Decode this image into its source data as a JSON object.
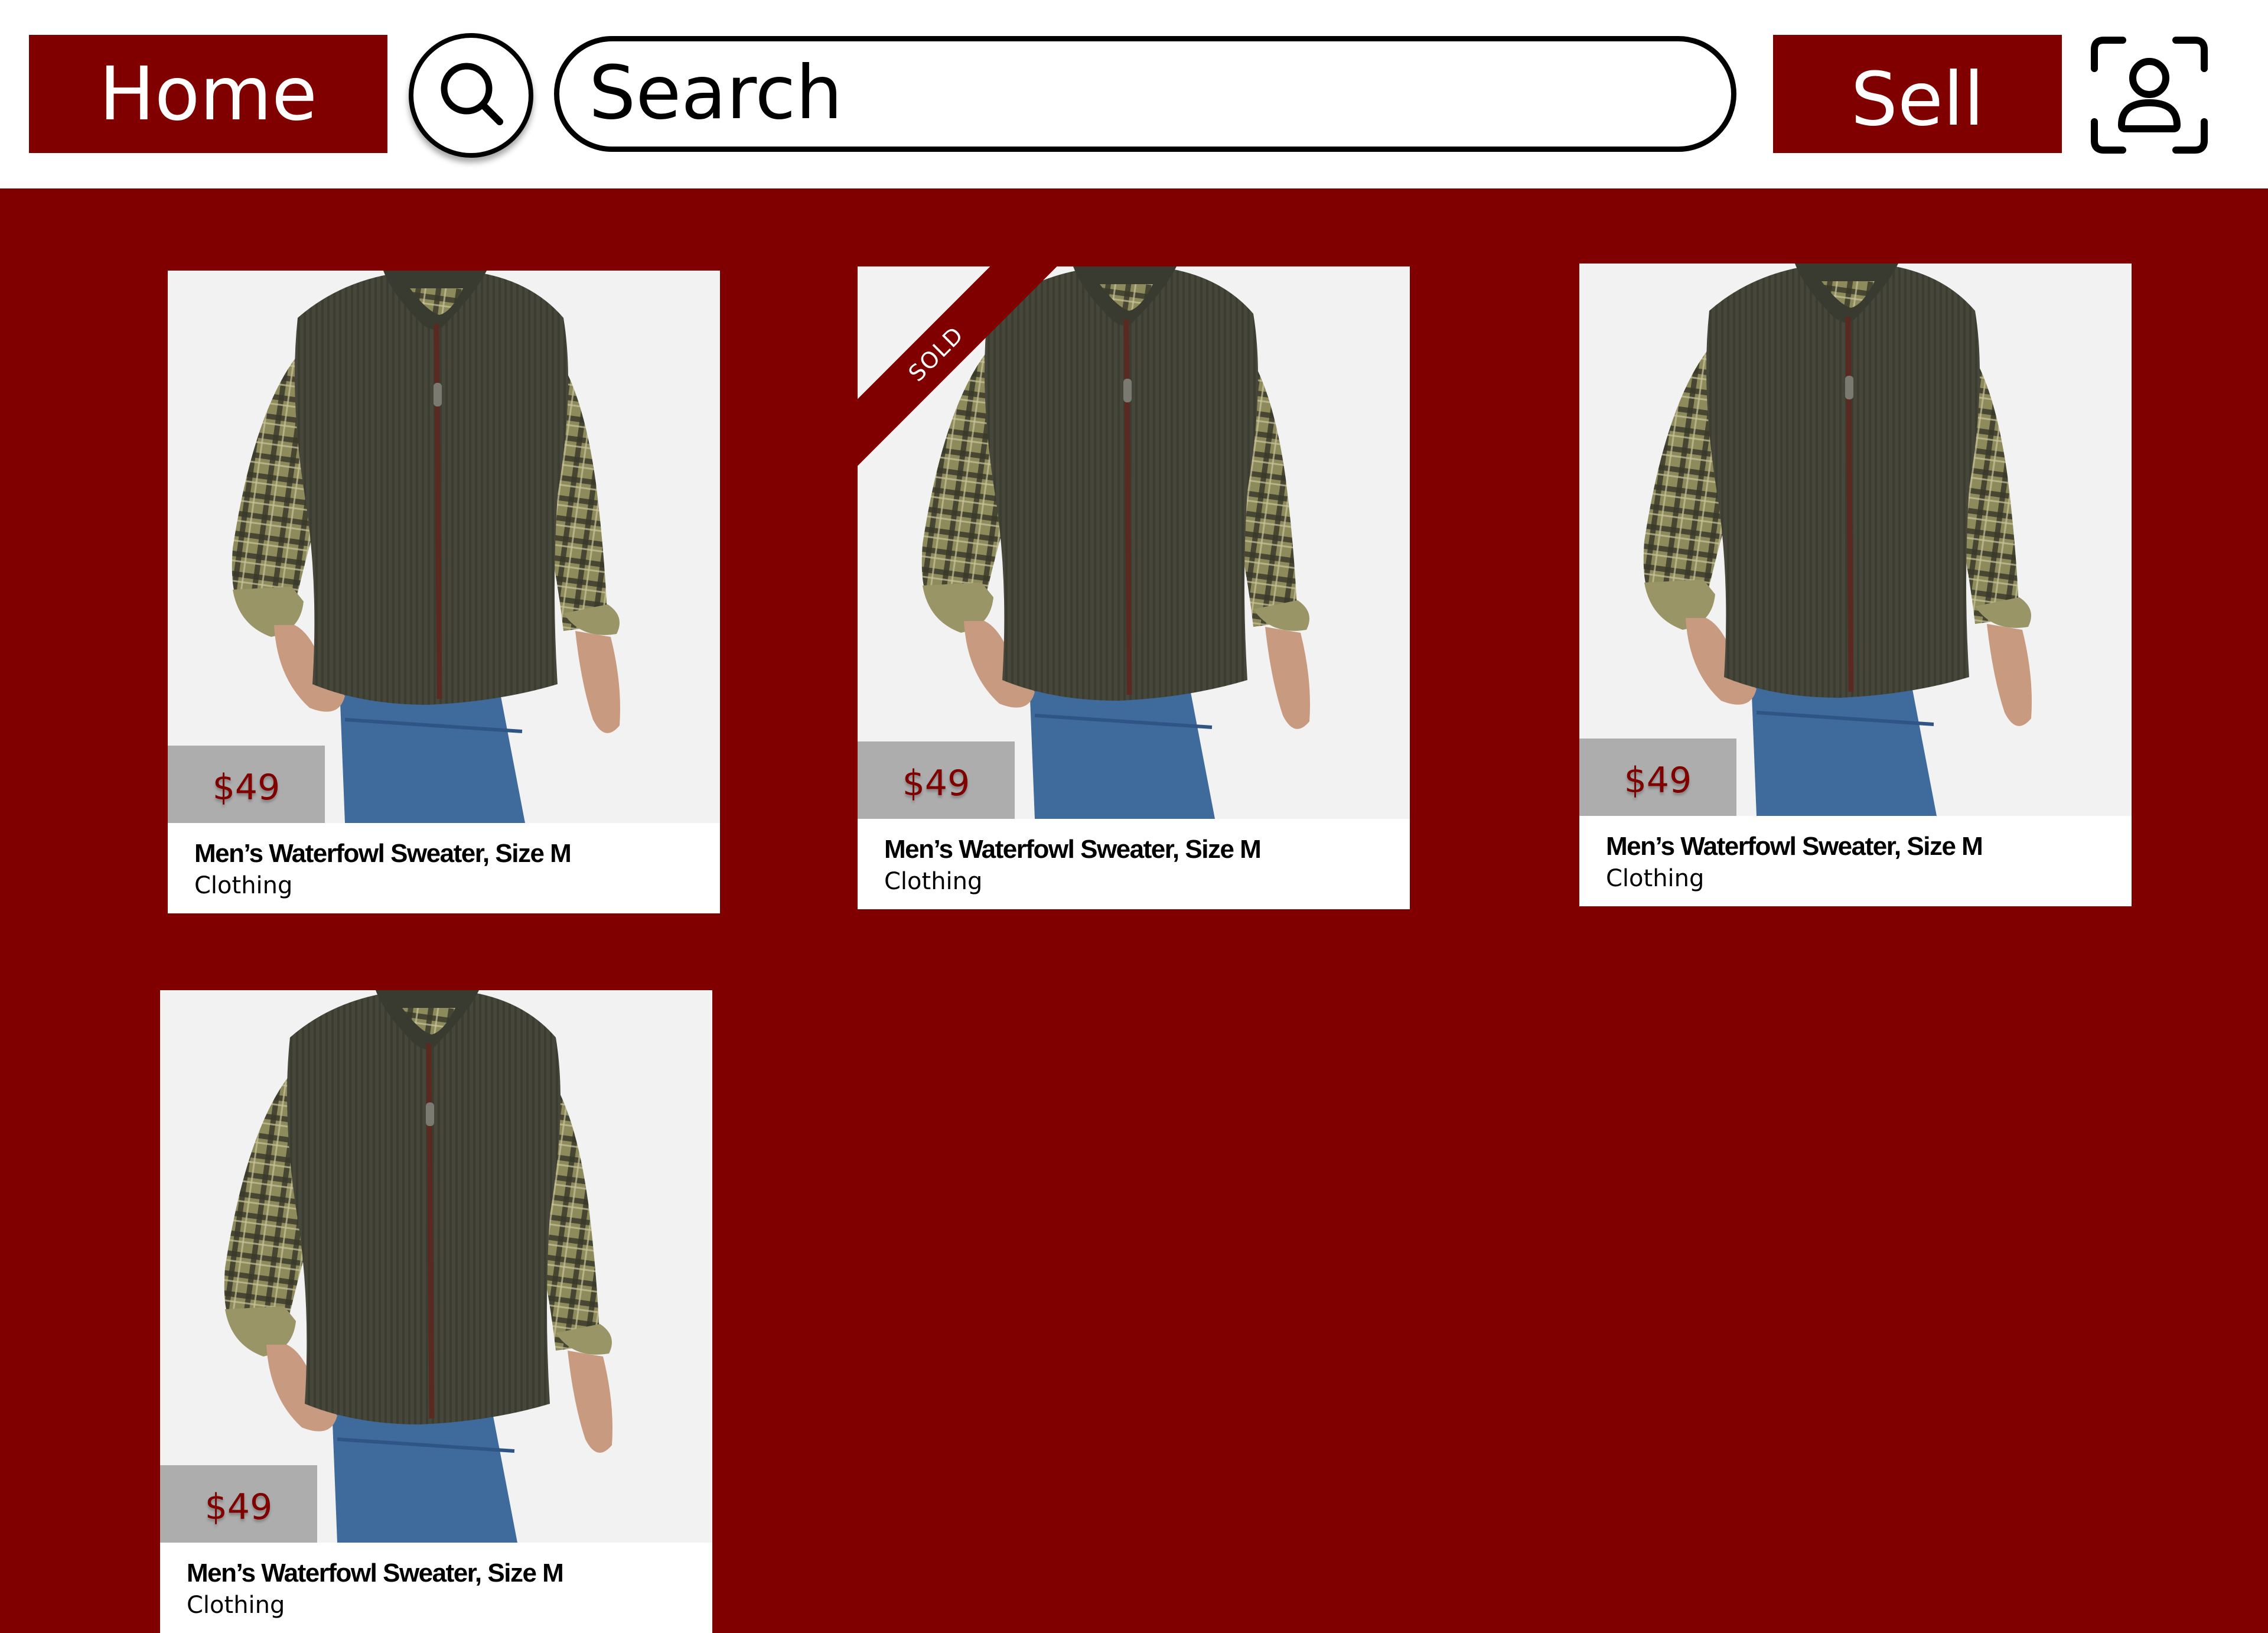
{
  "header": {
    "home_label": "Home",
    "search_placeholder": "Search",
    "sell_label": "Sell"
  },
  "icons": {
    "search": "search-icon",
    "profile": "user-scan-icon"
  },
  "colors": {
    "brand": "#800000",
    "header_bg": "#ffffff",
    "price_tag_bg": "#adadad"
  },
  "listings": [
    {
      "price": "$49",
      "title": "Men’s Waterfowl Sweater, Size M",
      "category": "Clothing",
      "sold": false
    },
    {
      "price": "$49",
      "title": "Men’s Waterfowl Sweater, Size M",
      "category": "Clothing",
      "sold": true,
      "sold_label": "SOLD"
    },
    {
      "price": "$49",
      "title": "Men’s Waterfowl Sweater, Size M",
      "category": "Clothing",
      "sold": false
    },
    {
      "price": "$49",
      "title": "Men’s Waterfowl Sweater, Size M",
      "category": "Clothing",
      "sold": false
    }
  ]
}
